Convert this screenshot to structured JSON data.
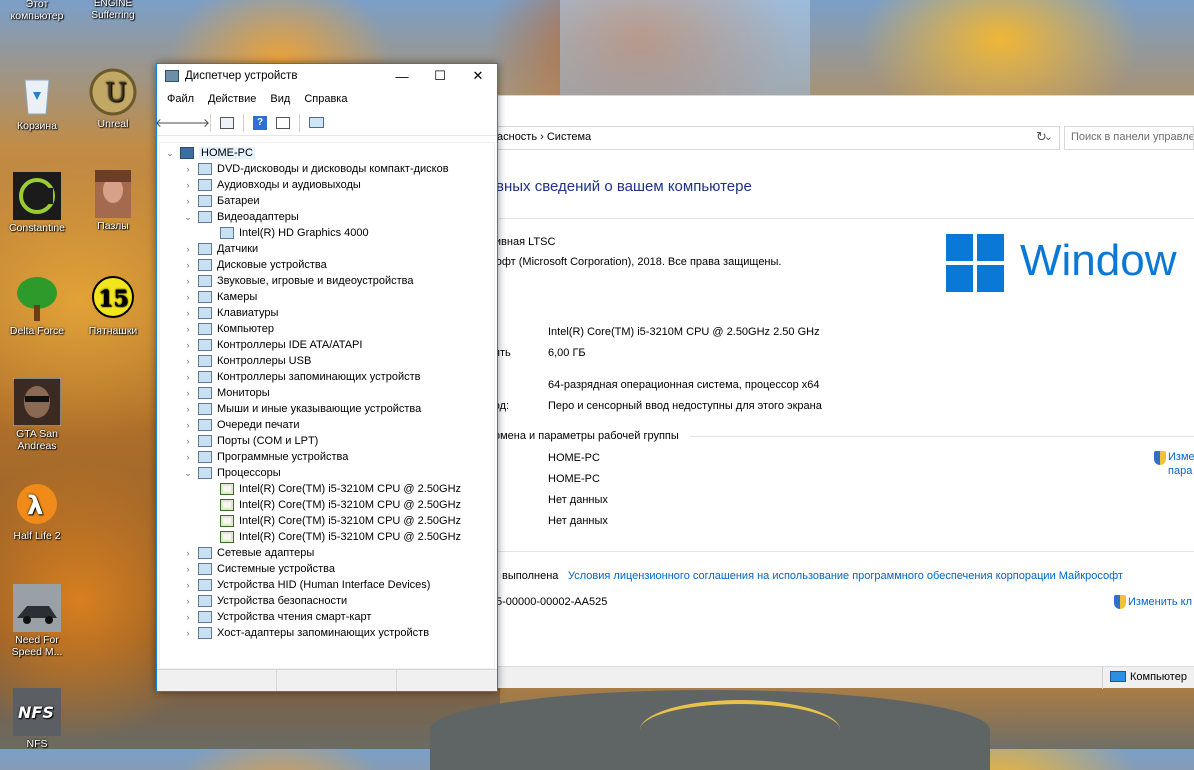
{
  "desktop_icons": [
    {
      "label": "Этот\nкомпьютер"
    },
    {
      "label": "ENGINE\nSufferring"
    },
    {
      "label": "Корзина"
    },
    {
      "label": "Unreal"
    },
    {
      "label": "Constantine"
    },
    {
      "label": "Пазлы"
    },
    {
      "label": "Delta Force"
    },
    {
      "label": "Пятнашки"
    },
    {
      "label": "GTA San Andreas"
    },
    {
      "label": "Half Life 2"
    },
    {
      "label": "Need For Speed M..."
    },
    {
      "label": "NFS"
    }
  ],
  "device_manager": {
    "title": "Диспетчер устройств",
    "menu": [
      "Файл",
      "Действие",
      "Вид",
      "Справка"
    ],
    "root": "HOME-PC",
    "categories": [
      {
        "label": "DVD-дисководы и дисководы компакт-дисков",
        "expanded": false
      },
      {
        "label": "Аудиовходы и аудиовыходы",
        "expanded": false
      },
      {
        "label": "Батареи",
        "expanded": false
      },
      {
        "label": "Видеоадаптеры",
        "expanded": true,
        "children": [
          "Intel(R) HD Graphics 4000"
        ]
      },
      {
        "label": "Датчики",
        "expanded": false
      },
      {
        "label": "Дисковые устройства",
        "expanded": false
      },
      {
        "label": "Звуковые, игровые и видеоустройства",
        "expanded": false
      },
      {
        "label": "Камеры",
        "expanded": false
      },
      {
        "label": "Клавиатуры",
        "expanded": false
      },
      {
        "label": "Компьютер",
        "expanded": false
      },
      {
        "label": "Контроллеры IDE ATA/ATAPI",
        "expanded": false
      },
      {
        "label": "Контроллеры USB",
        "expanded": false
      },
      {
        "label": "Контроллеры запоминающих устройств",
        "expanded": false
      },
      {
        "label": "Мониторы",
        "expanded": false
      },
      {
        "label": "Мыши и иные указывающие устройства",
        "expanded": false
      },
      {
        "label": "Очереди печати",
        "expanded": false
      },
      {
        "label": "Порты (COM и LPT)",
        "expanded": false
      },
      {
        "label": "Программные устройства",
        "expanded": false
      },
      {
        "label": "Процессоры",
        "expanded": true,
        "children": [
          "Intel(R) Core(TM) i5-3210M CPU @ 2.50GHz",
          "Intel(R) Core(TM) i5-3210M CPU @ 2.50GHz",
          "Intel(R) Core(TM) i5-3210M CPU @ 2.50GHz",
          "Intel(R) Core(TM) i5-3210M CPU @ 2.50GHz"
        ]
      },
      {
        "label": "Сетевые адаптеры",
        "expanded": false
      },
      {
        "label": "Системные устройства",
        "expanded": false
      },
      {
        "label": "Устройства HID (Human Interface Devices)",
        "expanded": false
      },
      {
        "label": "Устройства безопасности",
        "expanded": false
      },
      {
        "label": "Устройства чтения смарт-карт",
        "expanded": false
      },
      {
        "label": "Хост-адаптеры запоминающих устройств",
        "expanded": false
      }
    ]
  },
  "control_panel": {
    "breadcrumb": "асность  ›  Система",
    "search_placeholder": "Поиск в панели управле",
    "heading": "вных сведений о вашем компьютере",
    "edition": "ативная LTSC",
    "copyright": "ософт (Microsoft Corporation), 2018. Все права защищены.",
    "windows_logo_text": "Window",
    "processor": "Intel(R) Core(TM) i5-3210M CPU @ 2.50GHz   2.50 GHz",
    "memory_label": "ять",
    "memory": "6,00 ГБ",
    "system_type": "64-разрядная операционная система, процессор x64",
    "pen_label": "вод:",
    "pen_input": "Перо и сенсорный ввод недоступны для этого экрана",
    "workgroup_header": "омена и параметры рабочей группы",
    "computer_name": "HOME-PC",
    "full_name": "HOME-PC",
    "description": "Нет данных",
    "workgroup": "Нет данных",
    "change_settings": "Изме",
    "change_settings_2": "пара",
    "activation_label": "выполнена",
    "license_link": "Условия лицензионного соглашения на использование программного обеспечения корпорации Майкрософт",
    "product_id": "5-00000-00002-AA525",
    "change_key": "Изменить кл",
    "status_computer": "Компьютер"
  }
}
